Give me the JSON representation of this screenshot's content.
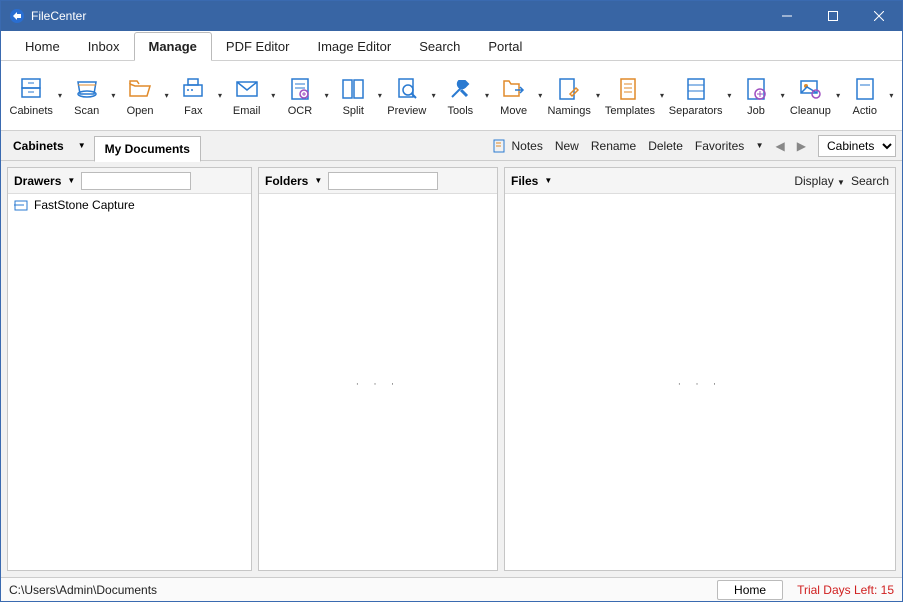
{
  "app": {
    "title": "FileCenter"
  },
  "menutabs": [
    "Home",
    "Inbox",
    "Manage",
    "PDF Editor",
    "Image Editor",
    "Search",
    "Portal"
  ],
  "activeTab": "Manage",
  "toolbar": [
    {
      "icon": "cabinets",
      "label": "Cabinets"
    },
    {
      "icon": "scan",
      "label": "Scan"
    },
    {
      "icon": "open",
      "label": "Open"
    },
    {
      "icon": "fax",
      "label": "Fax"
    },
    {
      "icon": "email",
      "label": "Email"
    },
    {
      "icon": "ocr",
      "label": "OCR"
    },
    {
      "icon": "split",
      "label": "Split"
    },
    {
      "icon": "preview",
      "label": "Preview"
    },
    {
      "icon": "tools",
      "label": "Tools"
    },
    {
      "icon": "move",
      "label": "Move"
    },
    {
      "icon": "namings",
      "label": "Namings"
    },
    {
      "icon": "templates",
      "label": "Templates"
    },
    {
      "icon": "separators",
      "label": "Separators"
    },
    {
      "icon": "job",
      "label": "Job"
    },
    {
      "icon": "cleanup",
      "label": "Cleanup"
    },
    {
      "icon": "actions",
      "label": "Actio"
    }
  ],
  "subbar": {
    "cabinets_label": "Cabinets",
    "current_tab": "My Documents",
    "notes": "Notes",
    "new": "New",
    "rename": "Rename",
    "delete": "Delete",
    "favorites": "Favorites",
    "select": "Cabinets"
  },
  "panels": {
    "drawers": {
      "title": "Drawers",
      "filter": ""
    },
    "folders": {
      "title": "Folders",
      "filter": ""
    },
    "files": {
      "title": "Files",
      "display": "Display",
      "search": "Search"
    }
  },
  "drawers_list": [
    {
      "name": "FastStone Capture"
    }
  ],
  "status": {
    "path": "C:\\Users\\Admin\\Documents",
    "home": "Home",
    "trial": "Trial Days Left: 15"
  },
  "colors": {
    "accent": "#3865a4",
    "toolblue": "#2a7ad1",
    "toolorange": "#e08a2a"
  }
}
